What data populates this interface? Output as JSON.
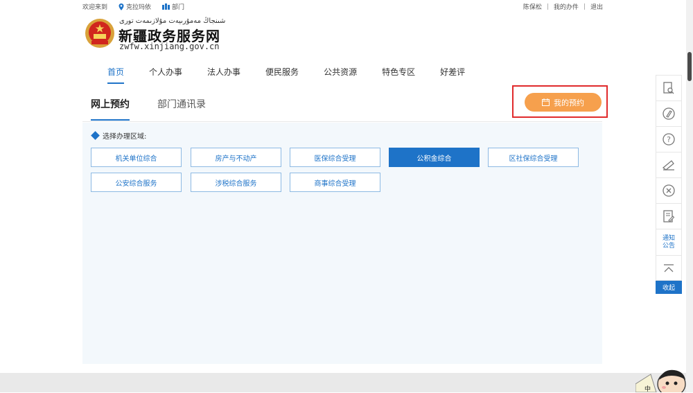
{
  "topbar": {
    "welcome": "欢迎来到",
    "location": "克拉玛依",
    "dept": "部门",
    "user": "陈保松",
    "my_affairs": "我的办件",
    "logout": "退出",
    "sep": "|"
  },
  "logo": {
    "uyghur": "شىنجاڭ مەمۇرىيەت مۇلازىمەت تورى",
    "cn": "新疆政务服务网",
    "url": "zwfw.xinjiang.gov.cn"
  },
  "nav": [
    "首页",
    "个人办事",
    "法人办事",
    "便民服务",
    "公共资源",
    "特色专区",
    "好差评"
  ],
  "subtabs": [
    "网上预约",
    "部门通讯录"
  ],
  "my_appointment": "我的预约",
  "panel": {
    "title": "选择办理区域:",
    "row1": [
      "机关单位综合",
      "房产与不动产",
      "医保综合受理",
      "公积金综合",
      "区社保综合受理"
    ],
    "row2": [
      "公安综合服务",
      "涉税综合服务",
      "商事综合受理"
    ],
    "active": "公积金综合"
  },
  "toolbar": {
    "notice": [
      "通知",
      "公告"
    ],
    "collapse": "收起"
  },
  "mascot_label": "中",
  "colors": {
    "primary": "#1e73c8",
    "orange": "#f6a04d",
    "highlight": "#e0292b"
  }
}
